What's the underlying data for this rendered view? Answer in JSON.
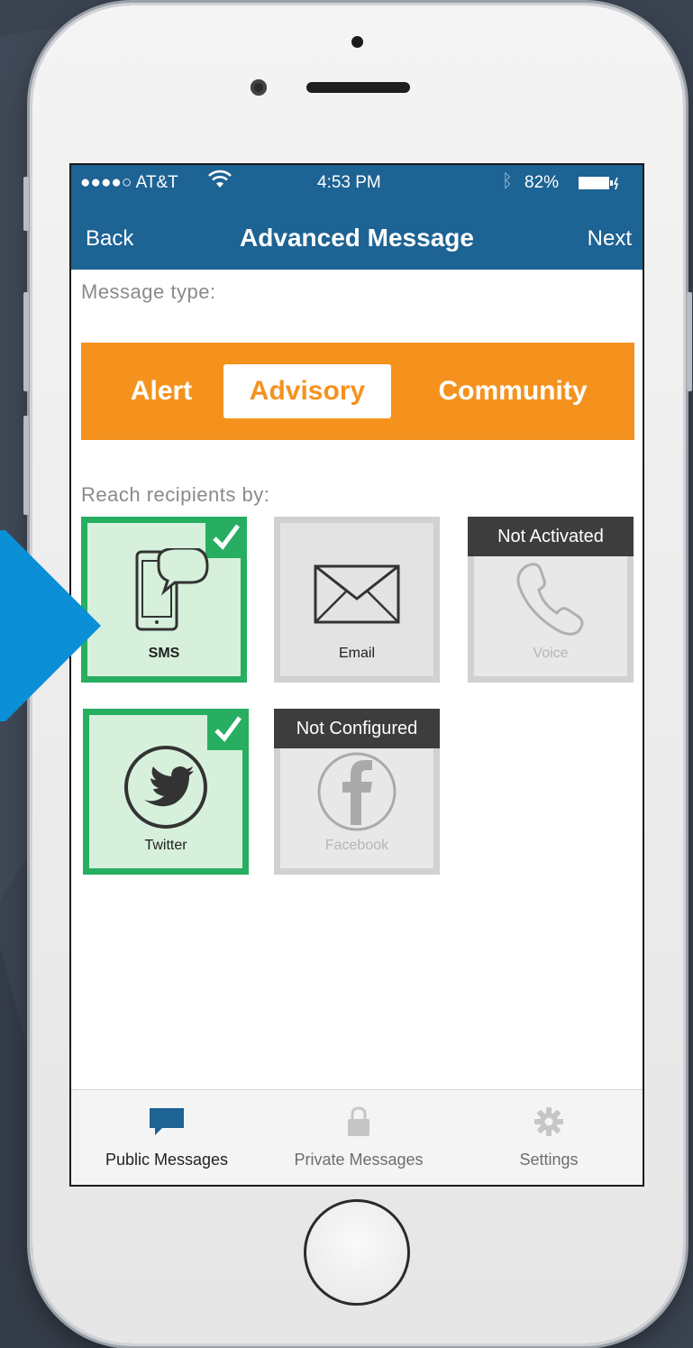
{
  "colors": {
    "navbar": "#1d6394",
    "segment": "#f5921e",
    "selected_border": "#27ae60",
    "arrow": "#0b8fd6",
    "background": "#3a4350"
  },
  "status_bar": {
    "carrier": "●●●●○ AT&T",
    "time": "4:53 PM",
    "battery": "82%"
  },
  "nav": {
    "back": "Back",
    "title": "Advanced Message",
    "next": "Next"
  },
  "message_type": {
    "label": "Message type:",
    "options": [
      "Alert",
      "Advisory",
      "Community"
    ],
    "selected": "Advisory"
  },
  "recipients": {
    "label": "Reach recipients by:",
    "channels": [
      {
        "name": "SMS",
        "state": "selected",
        "icon": "sms-phone-icon"
      },
      {
        "name": "Email",
        "state": "available",
        "icon": "envelope-icon"
      },
      {
        "name": "Voice",
        "state": "disabled",
        "badge": "Not Activated",
        "icon": "phone-handset-icon"
      },
      {
        "name": "Twitter",
        "state": "selected",
        "icon": "twitter-bird-icon"
      },
      {
        "name": "Facebook",
        "state": "disabled",
        "badge": "Not Configured",
        "icon": "facebook-icon"
      }
    ]
  },
  "tabbar": {
    "tabs": [
      {
        "label": "Public Messages",
        "icon": "chat-bubble-icon",
        "active": true
      },
      {
        "label": "Private Messages",
        "icon": "lock-icon",
        "active": false
      },
      {
        "label": "Settings",
        "icon": "gear-icon",
        "active": false
      }
    ]
  }
}
